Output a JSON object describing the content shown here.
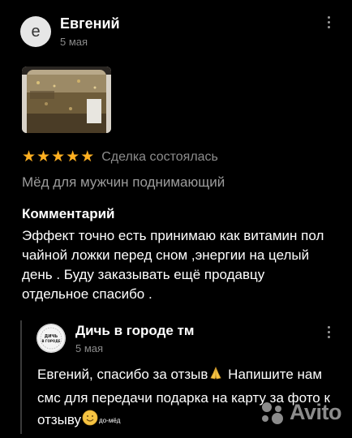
{
  "review": {
    "author_initial": "е",
    "author_name": "Евгений",
    "date": "5 мая",
    "rating": 5,
    "deal_status": "Сделка состоялась",
    "item_title": "Мёд для мужчин поднимающий",
    "comment_heading": "Комментарий",
    "comment_text": "Эффект точно есть принимаю как витамин пол чайной ложки перед сном ,энергии на целый день . Буду заказывать ещё продавцу отдельное спасибо ."
  },
  "reply": {
    "seller_avatar_label": "ДИЧЬ В ГОРОДЕ",
    "seller_name": "Дичь в городе тм",
    "date": "5 мая",
    "text_part1": "Евгений, спасибо за отзыв",
    "text_part2": " Напишите нам смс для передачи подарка на карту за фото к отзыву",
    "sticker_caption": "до-мёд"
  },
  "watermark": {
    "text": "Avito"
  },
  "colors": {
    "star": "#ffb021",
    "muted": "#8a8a8a",
    "background": "#000000"
  },
  "icons": {
    "star": "star-icon",
    "menu": "kebab-menu-icon",
    "praying_hands": "praying-hands-emoji",
    "smiley": "smiling-face-emoji",
    "logo": "avito-logo-icon"
  }
}
